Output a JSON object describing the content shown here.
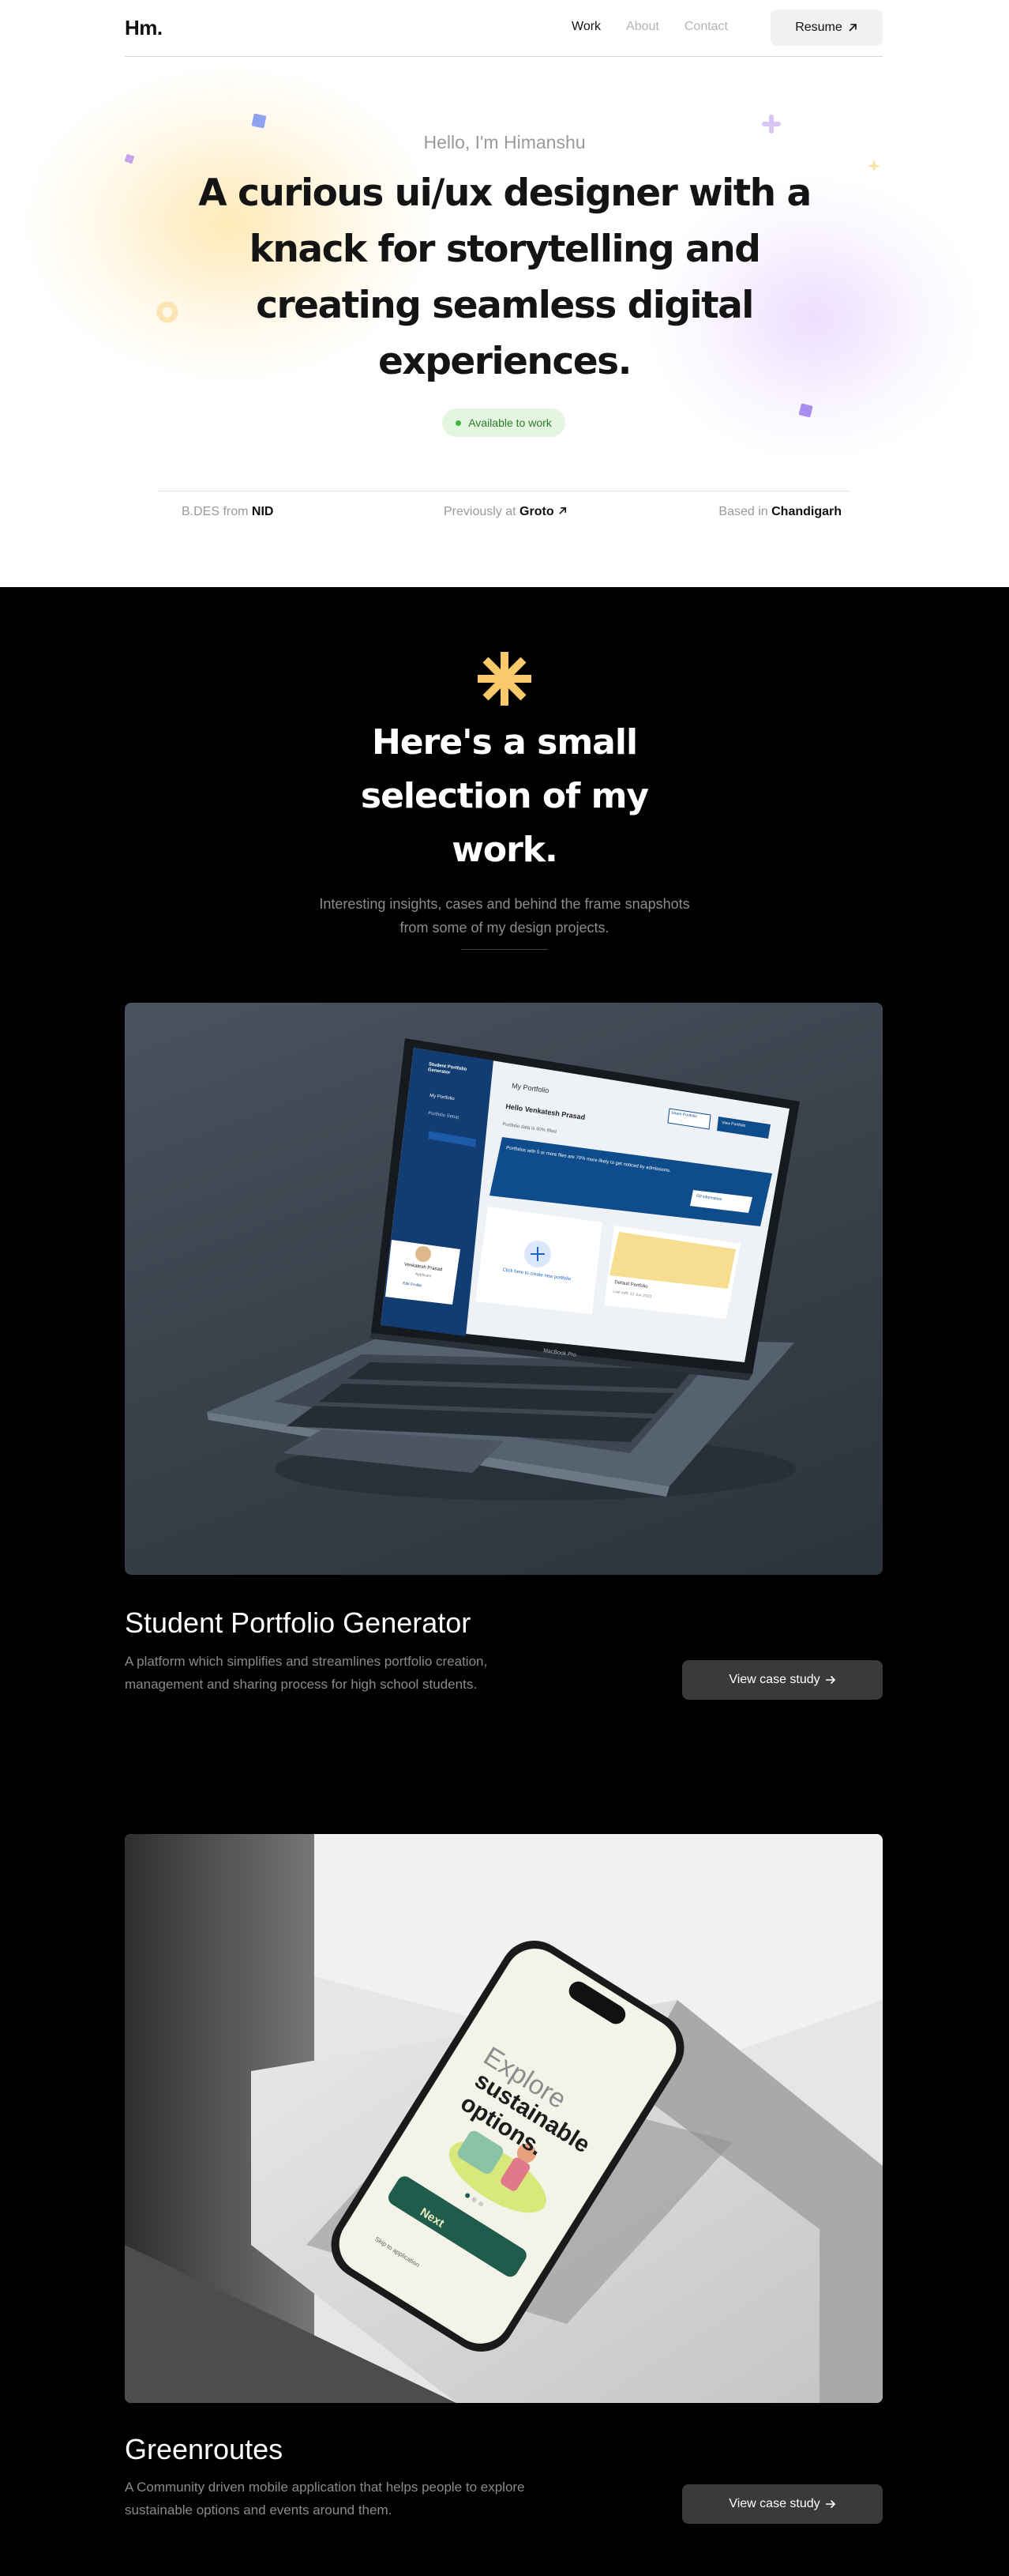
{
  "header": {
    "logo": "Hm.",
    "nav": [
      {
        "label": "Work",
        "active": true
      },
      {
        "label": "About",
        "active": false
      },
      {
        "label": "Contact",
        "active": false
      }
    ],
    "resume_label": "Resume",
    "resume_icon": "arrow-up-right-icon"
  },
  "hero": {
    "greeting": "Hello, I'm Himanshu",
    "headline": "A curious ui/ux designer with a knack for storytelling and creating seamless digital experiences.",
    "status_badge": "Available to work",
    "facts": [
      {
        "prefix": "B.DES from",
        "value": "NID"
      },
      {
        "prefix": "Previously at",
        "value": "Groto"
      },
      {
        "prefix": "Based in",
        "value": "Chandigarh"
      }
    ]
  },
  "work": {
    "title": "Here's a small selection of my work.",
    "subtitle": "Interesting insights, cases and behind the frame snapshots from some of my design projects.",
    "projects": [
      {
        "title": "Student Portfolio Generator",
        "description": "A platform which simplifies and streamlines portfolio creation, management and sharing process for high school students.",
        "cta": "View case study",
        "mockup": {
          "brand": "Student Portfolio Generator",
          "sidebar_items": [
            "My Portfolio",
            "Portfolio Setup"
          ],
          "breadcrumb": "My Portfolio",
          "greeting": "Hello Venkatesh Prasad",
          "progress_label": "Portfolio data is 40% filled",
          "btn_share": "Share Portfolio",
          "btn_view": "View Portfolio",
          "banner": "Portfolios with 5 or more files are 70% more likely to get noticed by admissions.",
          "banner_btn": "Fill information",
          "card_create": "Click here to create new portfolio",
          "card_default": "Default Portfolio",
          "card_date": "Last edit: 12 Jun 2023",
          "profile_name": "Venkatesh Prasad",
          "profile_role": "Applicant",
          "profile_btn": "Edit Profile",
          "laptop_label": "MacBook Pro"
        }
      },
      {
        "title": "Greenroutes",
        "description": "A Community driven mobile application that helps people to explore sustainable options and events around them.",
        "cta": "View case study",
        "mockup": {
          "headline_light": "Explore",
          "headline_bold": "sustainable options.",
          "next_btn": "Next",
          "skip": "Skip to application"
        }
      }
    ]
  },
  "colors": {
    "accent_yellow": "#f9c96a",
    "available_green": "#3fb43f",
    "app_blue": "#0f4c8c",
    "app_green": "#1f5c4c"
  }
}
